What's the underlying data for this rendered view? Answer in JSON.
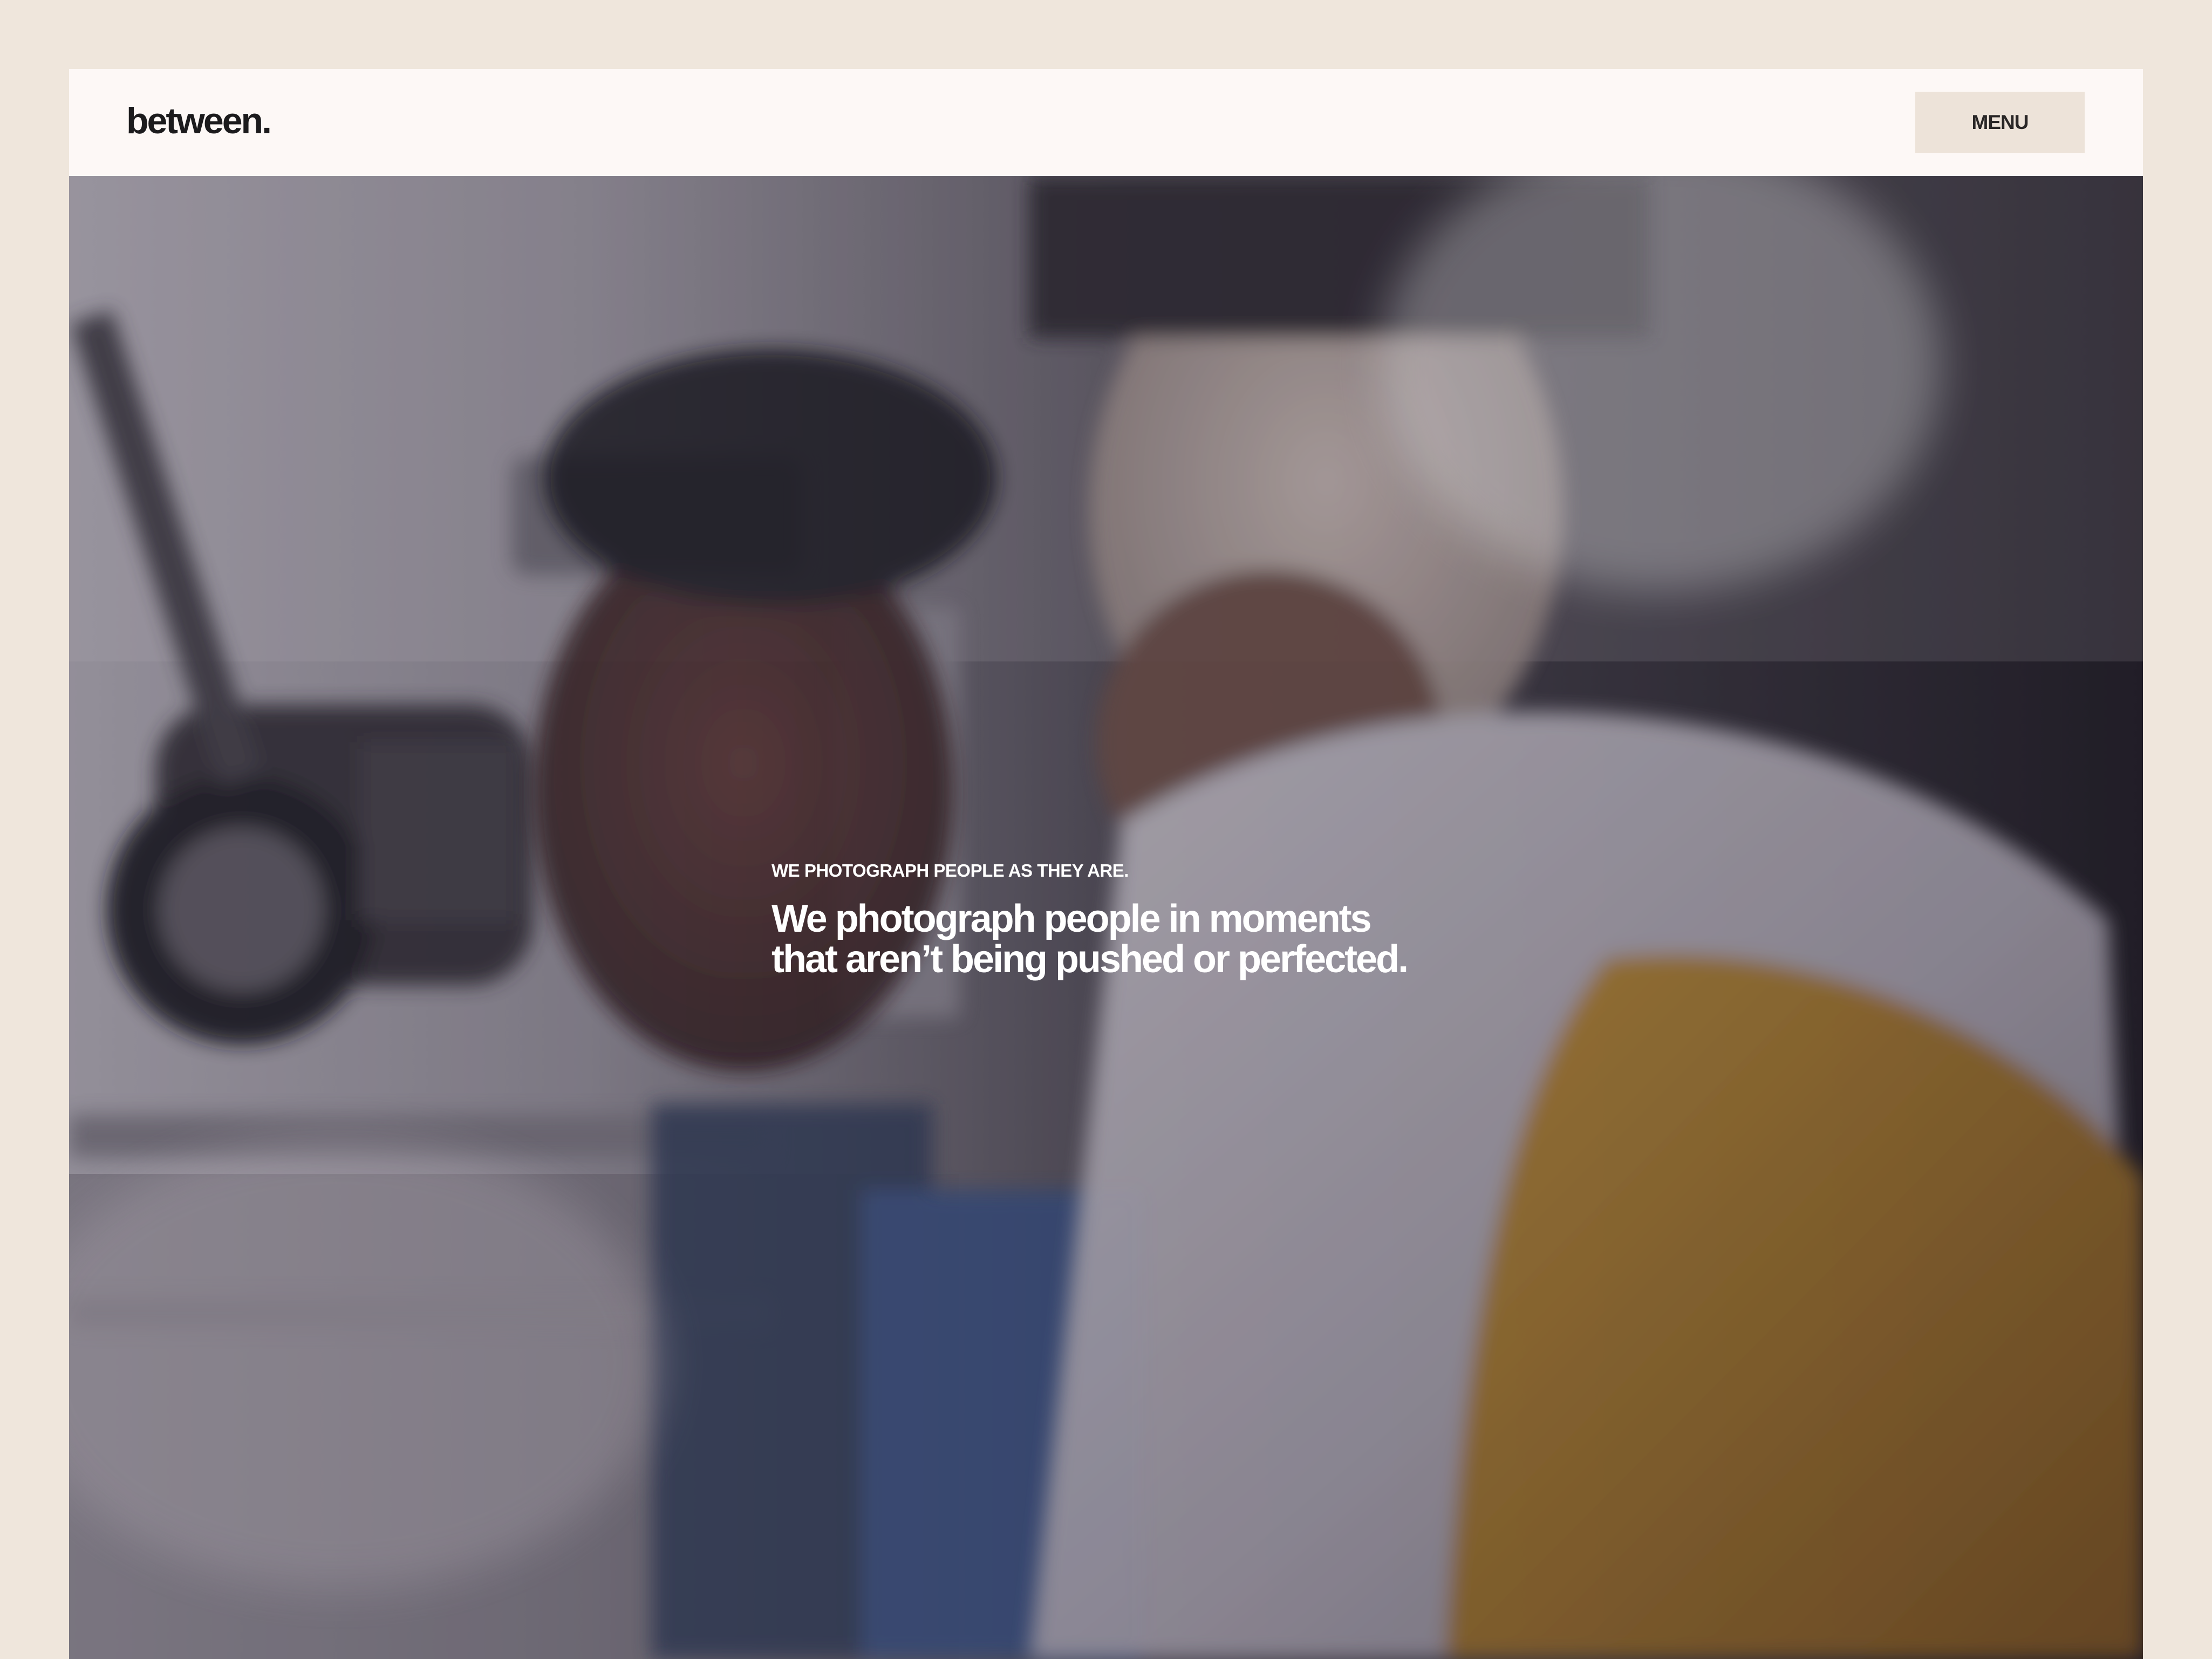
{
  "brand": {
    "logo_text": "between."
  },
  "header": {
    "menu_label": "MENU"
  },
  "hero": {
    "eyebrow": "WE PHOTOGRAPH PEOPLE AS THEY ARE.",
    "headline": "We photograph people in moments that aren’t being pushed or perfected.",
    "image_description": "Film crew operating a cinema camera"
  },
  "colors": {
    "page_background": "#efe6dc",
    "header_background": "#fdf8f6",
    "menu_button_background": "#ede3d9",
    "text_dark": "#1c1b1d",
    "text_light": "#ffffff"
  }
}
